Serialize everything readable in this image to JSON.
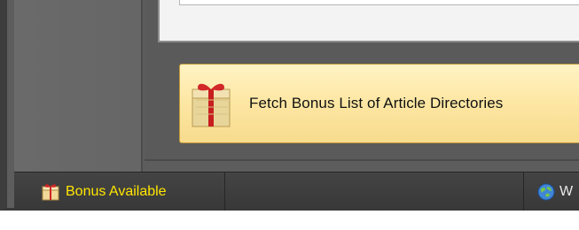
{
  "main": {
    "bonus_button_label": "Fetch Bonus List of Article Directories"
  },
  "statusbar": {
    "bonus_label": "Bonus Available",
    "right_label": "W"
  },
  "icons": {
    "bonus_button_icon": "gift-icon",
    "bonus_status_icon": "gift-icon",
    "right_status_icon": "globe-icon"
  },
  "colors": {
    "bonus_status_text": "#ffe600",
    "button_fill": "#fde7a4"
  }
}
